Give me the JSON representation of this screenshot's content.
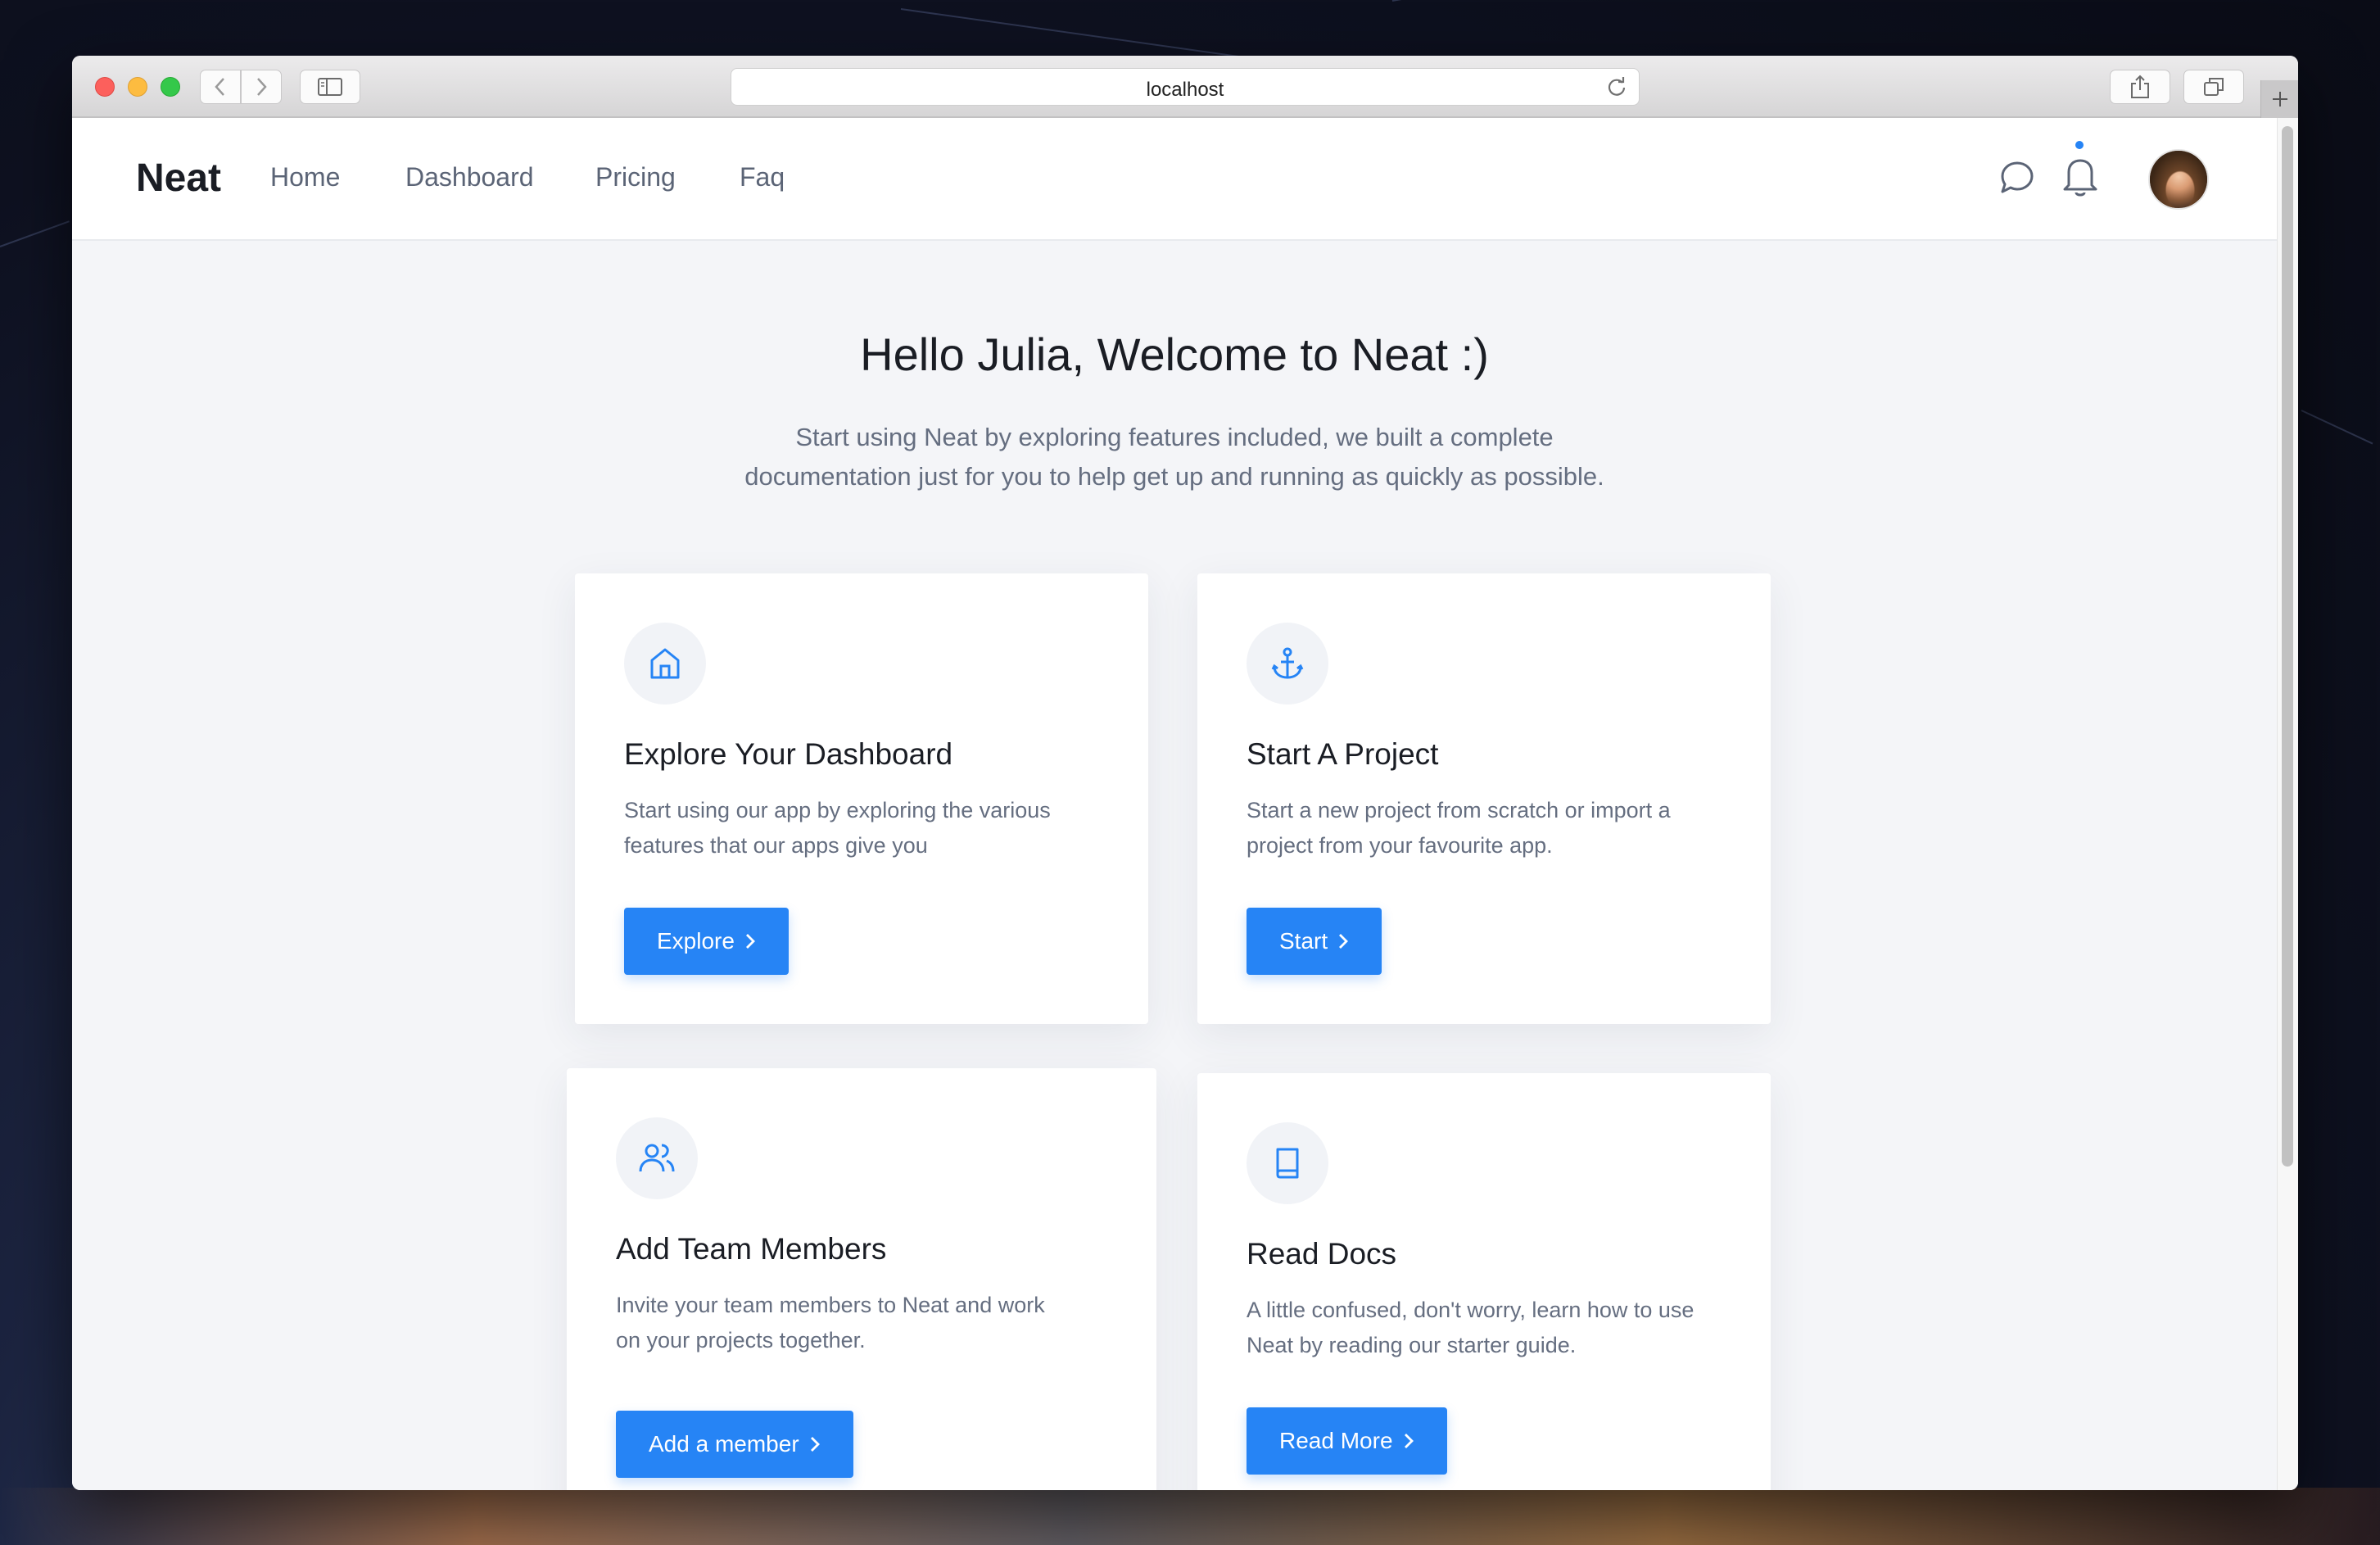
{
  "browser": {
    "url": "localhost"
  },
  "navbar": {
    "brand": "Neat",
    "links": [
      "Home",
      "Dashboard",
      "Pricing",
      "Faq"
    ]
  },
  "hero": {
    "title": "Hello Julia, Welcome to Neat :)",
    "subtitle_line1": "Start using Neat by exploring features included, we built a complete",
    "subtitle_line2": "documentation just for you to help get up and running as quickly as possible."
  },
  "cards": [
    {
      "icon": "home-icon",
      "title": "Explore Your Dashboard",
      "desc_line1": "Start using our app by exploring the various",
      "desc_line2": "features that our apps give you",
      "button": "Explore"
    },
    {
      "icon": "anchor-icon",
      "title": "Start A Project",
      "desc_line1": "Start a new project from scratch or import a",
      "desc_line2": "project from your favourite app.",
      "button": "Start"
    },
    {
      "icon": "users-icon",
      "title": "Add Team Members",
      "desc_line1": "Invite your team members to Neat and work",
      "desc_line2": "on your projects together.",
      "button": "Add a member"
    },
    {
      "icon": "book-icon",
      "title": "Read Docs",
      "desc_line1": "A little confused, don't worry, learn how to use",
      "desc_line2": "Neat by reading our starter guide.",
      "button": "Read More"
    }
  ],
  "colors": {
    "accent": "#2684f5",
    "text_dark": "#1a1d24",
    "text_muted": "#656e80",
    "page_bg": "#f4f5f8"
  }
}
